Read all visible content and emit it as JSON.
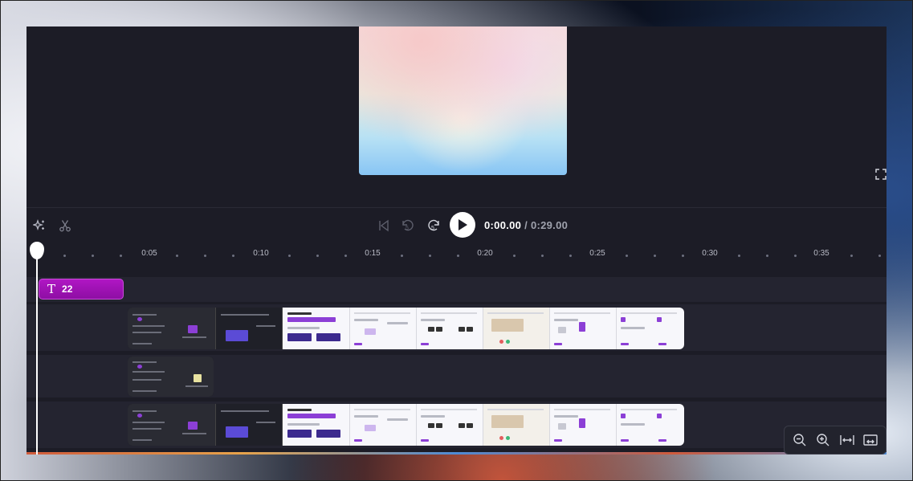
{
  "player": {
    "current_time": "0:00.00",
    "separator": " / ",
    "duration": "0:29.00",
    "skip_back_seconds": "5",
    "skip_forward_seconds": "5"
  },
  "ruler": {
    "labels": [
      "0:05",
      "0:10",
      "0:15",
      "0:20",
      "0:25",
      "0:30",
      "0:35"
    ]
  },
  "tracks": {
    "text_clip_label": "22",
    "text_clip_icon": "text-T-icon"
  },
  "icons": {
    "magic": "sparkle-icon",
    "split": "scissors-icon",
    "to_start": "skip-to-start-icon",
    "rewind": "rewind-5-icon",
    "forward": "forward-5-icon",
    "play": "play-icon",
    "fullscreen": "fullscreen-icon",
    "zoom_out": "zoom-out-icon",
    "zoom_in": "zoom-in-icon",
    "fit": "fit-to-width-icon",
    "fit_screen": "fit-to-screen-icon"
  },
  "colors": {
    "accent": "#9b12b0",
    "background": "#1c1c26",
    "track": "#242430"
  }
}
